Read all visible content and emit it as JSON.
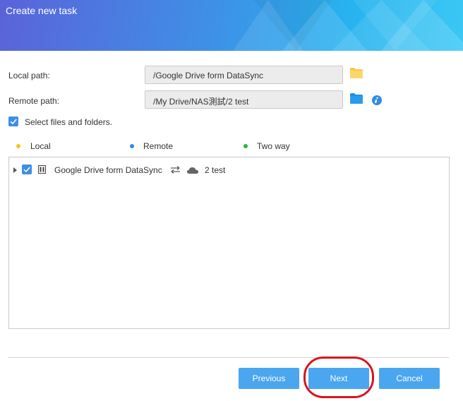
{
  "dialog": {
    "title": "Create new task"
  },
  "form": {
    "local_path_label": "Local path:",
    "local_path_value": "/Google Drive form DataSync",
    "remote_path_label": "Remote path:",
    "remote_path_value": "/My Drive/NAS測試/2 test",
    "select_files_label": "Select files and folders.",
    "select_files_checked": true
  },
  "legend": {
    "items": [
      {
        "label": "Local",
        "color": "#f5c518"
      },
      {
        "label": "Remote",
        "color": "#2e8ce6"
      },
      {
        "label": "Two way",
        "color": "#2db33d"
      }
    ]
  },
  "tree": {
    "rows": [
      {
        "source_name": "Google Drive form DataSync",
        "sync_direction": "two-way-arrows",
        "target_name": "2 test",
        "checked": true,
        "expanded": false
      }
    ]
  },
  "buttons": {
    "previous_label": "Previous",
    "next_label": "Next",
    "cancel_label": "Cancel"
  },
  "colors": {
    "button_blue": "#4aa6ef",
    "folder_yellow": "#f7c94c",
    "folder_blue": "#1f8fe0",
    "highlight_red": "#d8161b"
  }
}
